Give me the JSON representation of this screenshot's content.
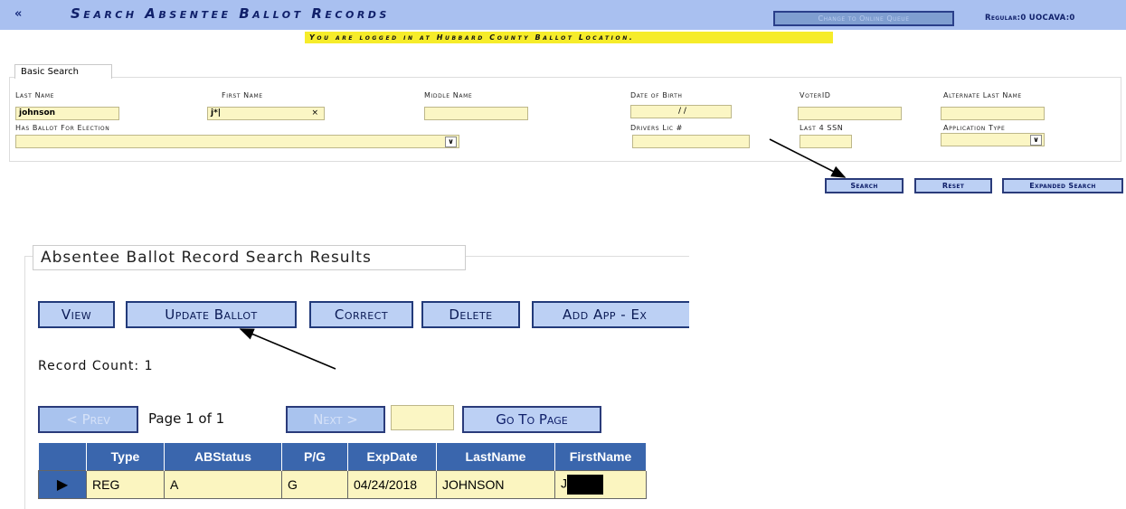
{
  "header": {
    "collapse_icon": "«",
    "title": "Search Absentee Ballot Records",
    "location_banner": "You are logged in at Hubbard County Ballot Location.",
    "queue_button": "Change to Online Queue",
    "counts": "Regular:0 UOCAVA:0"
  },
  "basic_search": {
    "legend": "Basic Search",
    "last_name_label": "Last Name",
    "last_name_value": "johnson",
    "first_name_label": "First Name",
    "first_name_value": "j*|",
    "first_name_clear": "×",
    "middle_name_label": "Middle Name",
    "dob_label": "Date of Birth",
    "dob_value": "/   /",
    "voterid_label": "VoterID",
    "alt_last_name_label": "Alternate Last Name",
    "has_ballot_label": "Has Ballot For Election",
    "drivers_lic_label": "Drivers Lic #",
    "ssn_label": "Last 4 SSN",
    "app_type_label": "Application Type",
    "search_button": "Search",
    "reset_button": "Reset",
    "expanded_button": "Expanded Search"
  },
  "results": {
    "legend": "Absentee Ballot Record Search Results",
    "actions": [
      "View",
      "Update Ballot",
      "Correct",
      "Delete",
      "Add App - Ex"
    ],
    "record_count": "Record  Count:  1",
    "prev_button": "< Prev",
    "page_text": "Page 1 of 1",
    "next_button": "Next >",
    "goto_button": "Go To Page",
    "columns": [
      "Type",
      "ABStatus",
      "P/G",
      "ExpDate",
      "LastName",
      "FirstName"
    ],
    "rows": [
      {
        "type": "REG",
        "abstatus": "A",
        "pg": "G",
        "expdate": "04/24/2018",
        "lastname": "JOHNSON",
        "firstname": "J"
      }
    ]
  }
}
